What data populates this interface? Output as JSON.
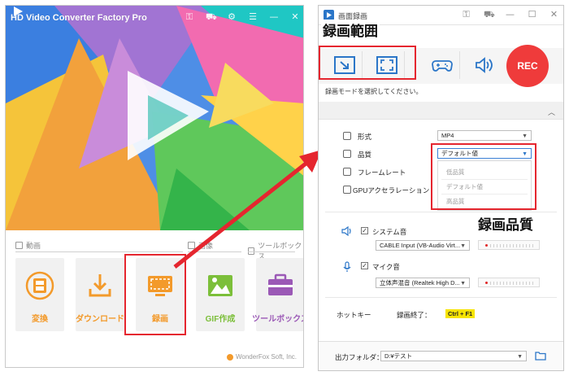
{
  "left_window": {
    "title": "HD Video Converter Factory Pro",
    "sections": {
      "video": "動画",
      "image": "画像",
      "toolbox": "ツールボックス"
    },
    "tiles": [
      {
        "label": "変換",
        "color": "#f39a2b",
        "icon": "film-icon"
      },
      {
        "label": "ダウンロード",
        "color": "#f39a2b",
        "icon": "download-icon"
      },
      {
        "label": "録画",
        "color": "#f39a2b",
        "icon": "screen-record-icon"
      },
      {
        "label": "GIF作成",
        "color": "#7cbf3a",
        "icon": "image-icon"
      },
      {
        "label": "ツールボックス",
        "color": "#9b59b6",
        "icon": "toolbox-icon"
      }
    ],
    "brand": "WonderFox Soft, Inc."
  },
  "right_window": {
    "title": "画面録画",
    "rec_label": "REC",
    "mode_hint": "録画モードを選択してください。",
    "format_label": "形式",
    "format_value": "MP4",
    "quality_label": "品質",
    "quality_value": "デフォルト値",
    "quality_options": [
      "低品質",
      "デフォルト値",
      "高品質"
    ],
    "framerate_label": "フレームレート",
    "gpu_label": "GPUアクセラレーション",
    "system_audio_label": "システム音",
    "system_audio_device": "CABLE Input (VB-Audio Virt...",
    "mic_label": "マイク音",
    "mic_device": "立体声混音 (Realtek High D...",
    "hotkey_label": "ホットキー",
    "stop_label": "録画終了：",
    "stop_key": "Ctrl + F1",
    "output_label": "出力フォルダ：",
    "output_path": "D:¥テスト"
  },
  "annotations": {
    "record_range": "録画範囲",
    "record_quality": "録画品質"
  },
  "colors": {
    "accent_red": "#e5262f",
    "rec_red": "#ef3b3b",
    "tile_orange": "#f39a2b",
    "tile_green": "#7cbf3a",
    "tile_purple": "#9b59b6",
    "link_blue": "#2b76c8"
  }
}
